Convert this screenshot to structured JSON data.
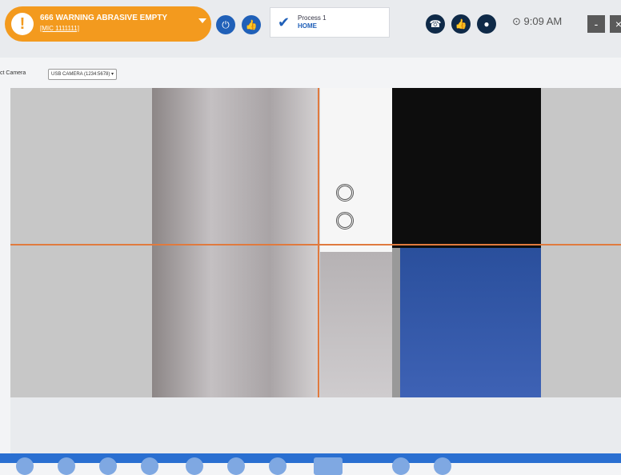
{
  "alert": {
    "title": "666 WARNING ABRASIVE EMPTY",
    "subtitle": "[MIC 1111111]"
  },
  "process": {
    "title": "Process 1",
    "subtitle": "HOME"
  },
  "clock": {
    "time": "9:09 AM"
  },
  "camera": {
    "label": "ct Camera",
    "selected": "USB CAMERA (1234:5678) ▾"
  },
  "colors": {
    "alert": "#f39a1e",
    "accent_blue": "#2060b8",
    "crosshair": "#e07a3e",
    "bottom_bar": "#2a6fd1"
  }
}
